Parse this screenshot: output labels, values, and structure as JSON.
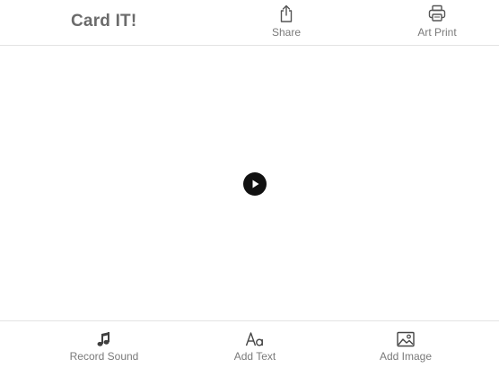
{
  "app": {
    "title": "Card IT!"
  },
  "header": {
    "share": {
      "label": "Share",
      "icon": "share-icon"
    },
    "print": {
      "label": "Art Print",
      "icon": "printer-icon"
    }
  },
  "canvas": {
    "play_icon": "play-icon"
  },
  "toolbar": {
    "record_sound": {
      "label": "Record Sound",
      "icon": "music-note-icon"
    },
    "add_text": {
      "label": "Add Text",
      "icon": "text-aa-icon"
    },
    "add_image": {
      "label": "Add Image",
      "icon": "image-icon"
    }
  },
  "colors": {
    "text_gray": "#7a7a7a",
    "title_gray": "#6b6b6b",
    "icon_dark": "#444444",
    "divider": "#e3e3e3",
    "play_bg": "#111111"
  }
}
